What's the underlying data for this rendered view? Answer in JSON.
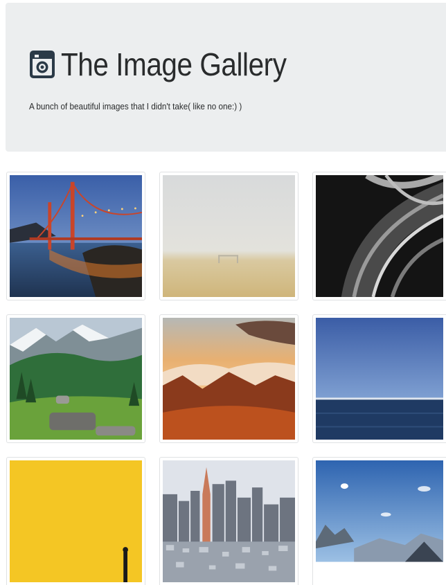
{
  "header": {
    "title": "The Image Gallery",
    "subtitle": "A bunch of beautiful images that I didn't take( like no one:) )",
    "icon": "camera-icon"
  },
  "gallery": {
    "images": [
      {
        "name": "golden-gate-bridge-image"
      },
      {
        "name": "foggy-beach-image"
      },
      {
        "name": "abstract-architecture-image"
      },
      {
        "name": "green-mountain-valley-image"
      },
      {
        "name": "sunset-mountains-image"
      },
      {
        "name": "calm-ocean-horizon-image"
      },
      {
        "name": "yellow-wall-image"
      },
      {
        "name": "city-skyline-image"
      },
      {
        "name": "alpine-peaks-image"
      }
    ]
  },
  "colors": {
    "jumbotron_bg": "#eceeef",
    "text": "#292b2c",
    "card_border": "#dfe1e3"
  }
}
